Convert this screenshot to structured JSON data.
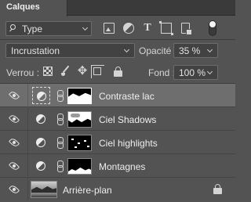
{
  "panel": {
    "tab_title": "Calques"
  },
  "filter": {
    "kind_label": "Type",
    "search_icon": "search-icon",
    "icons": [
      "image-filter-icon",
      "adjustment-filter-icon",
      "type-filter-icon",
      "shape-filter-icon",
      "smart-object-filter-icon"
    ]
  },
  "blend": {
    "mode": "Incrustation",
    "opacity_label": "Opacité :",
    "opacity_value": "35 %"
  },
  "lock": {
    "label": "Verrou :",
    "fill_label": "Fond :",
    "fill_value": "100 %"
  },
  "layers": [
    {
      "name": "Contraste lac",
      "visible": true,
      "selected": true,
      "type": "adjustment"
    },
    {
      "name": "Ciel Shadows",
      "visible": true,
      "selected": false,
      "type": "adjustment"
    },
    {
      "name": "Ciel highlights",
      "visible": true,
      "selected": false,
      "type": "adjustment"
    },
    {
      "name": "Montagnes",
      "visible": true,
      "selected": false,
      "type": "adjustment"
    },
    {
      "name": "Arrière-plan",
      "visible": true,
      "selected": false,
      "type": "background",
      "locked": true
    }
  ],
  "colors": {
    "panel_bg": "#535353",
    "selected_row": "#6e6e6e",
    "field_bg": "#424242"
  }
}
